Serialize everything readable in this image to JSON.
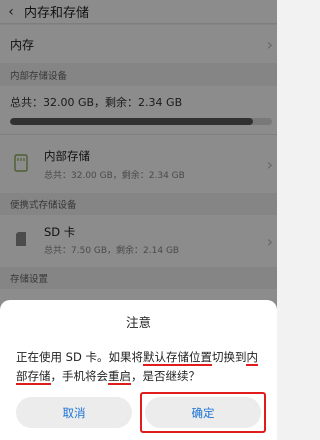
{
  "header": {
    "back_icon": "back-arrow-icon",
    "title": "内存和存储"
  },
  "memory_row": {
    "label": "内存"
  },
  "internal_section": {
    "header": "内部存储设备",
    "summary": "总共：32.00 GB，剩余：2.34 GB",
    "used_fraction": 0.927
  },
  "internal_device": {
    "icon": "sd-chip-icon",
    "name": "内部存储",
    "detail": "总共：32.00 GB，剩余：2.34 GB"
  },
  "portable_section": {
    "header": "便携式存储设备"
  },
  "sd_device": {
    "icon": "sd-card-icon",
    "name": "SD 卡",
    "detail": "总共：7.50 GB，剩余：2.14 GB"
  },
  "settings_section": {
    "header": "存储设置"
  },
  "dialog": {
    "title": "注意",
    "msg_1": "正在使用 SD 卡。如果将",
    "msg_2": "默认存储位置",
    "msg_3": "切换到",
    "msg_4": "内部存储",
    "msg_5": "，手机将会",
    "msg_6": "重启",
    "msg_7": "，是否继续？",
    "cancel_label": "取消",
    "ok_label": "确定"
  },
  "colors": {
    "accent": "#1b73d6",
    "highlight": "#e01c1c",
    "bar_fill": "#5a5a5a"
  }
}
